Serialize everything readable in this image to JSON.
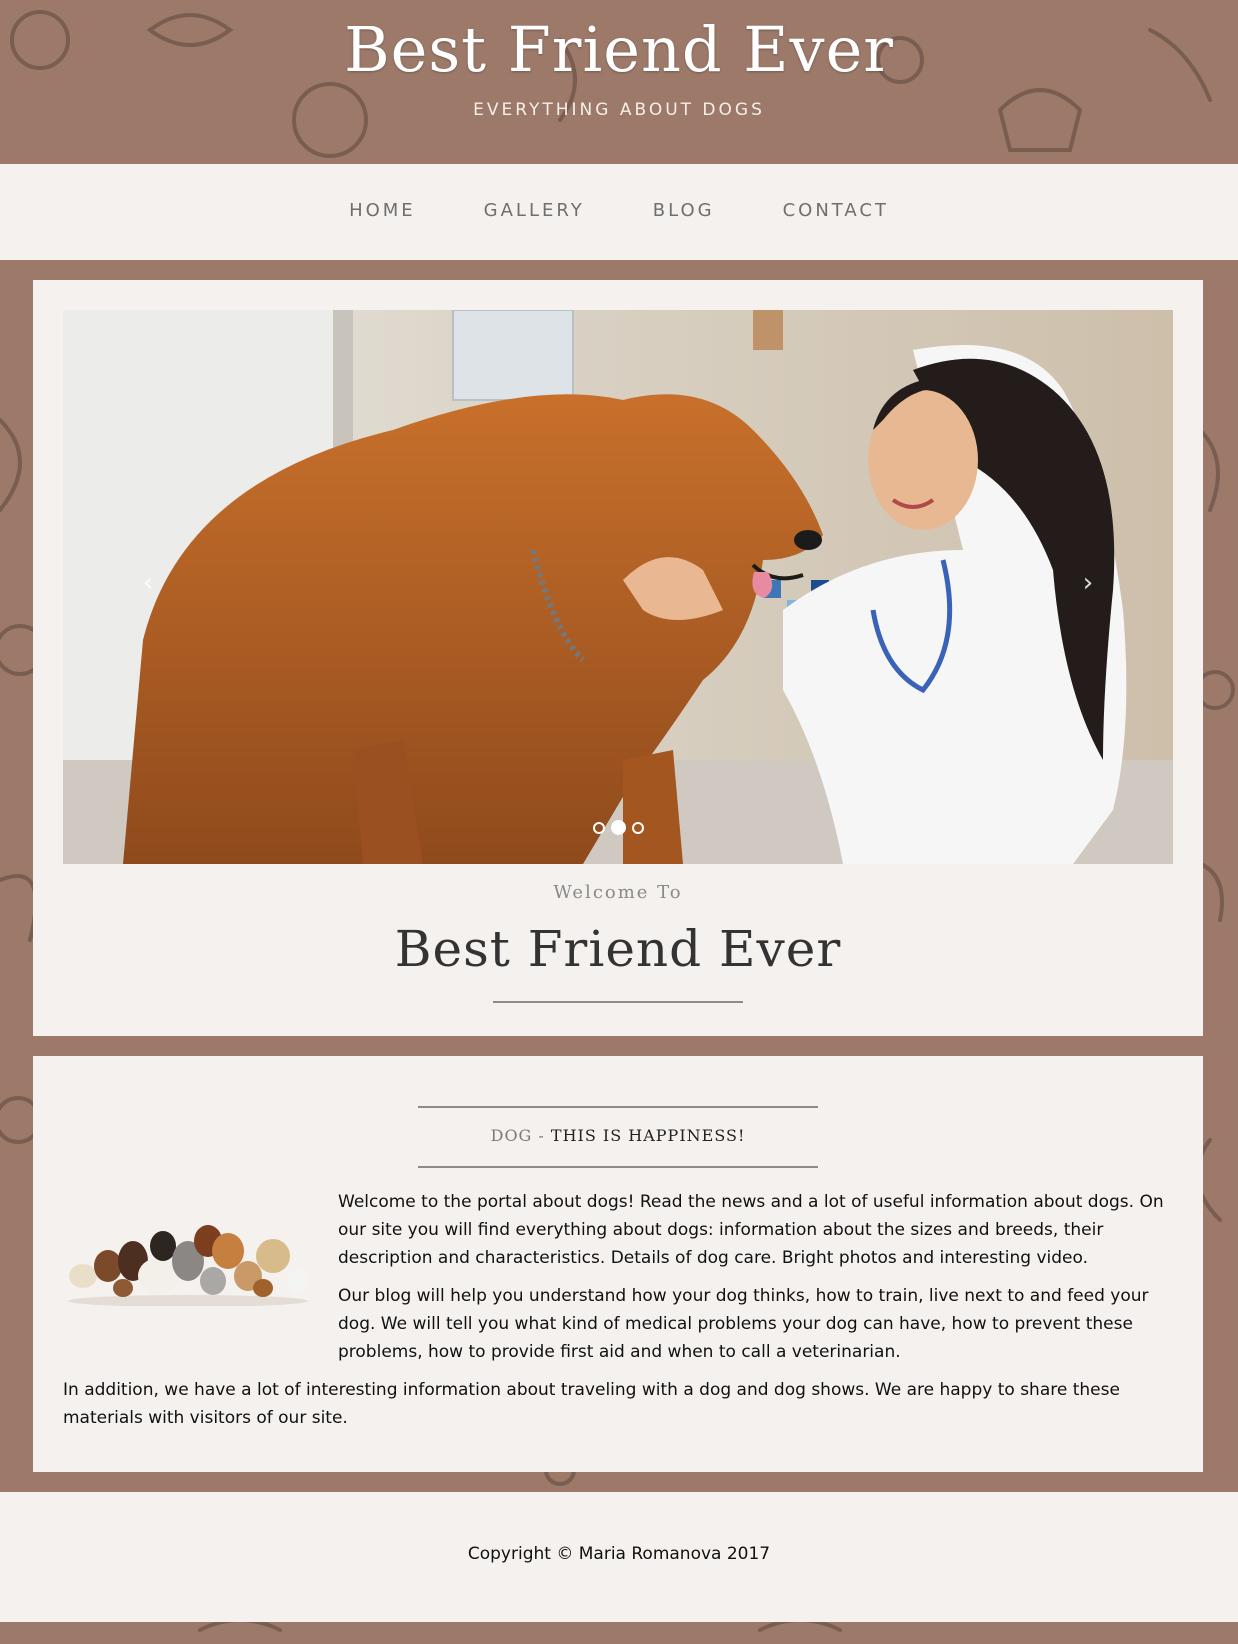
{
  "header": {
    "title": "Best Friend Ever",
    "tagline": "EVERYTHING ABOUT DOGS"
  },
  "nav": {
    "items": [
      {
        "label": "HOME"
      },
      {
        "label": "GALLERY"
      },
      {
        "label": "BLOG"
      },
      {
        "label": "CONTACT"
      }
    ]
  },
  "slider": {
    "prev_icon": "‹",
    "next_icon": "›",
    "slide_count": 3,
    "active_slide": 2
  },
  "welcome": {
    "small": "Welcome To",
    "title": "Best Friend Ever"
  },
  "about": {
    "heading_light": "DOG -",
    "heading_dark": "THIS IS HAPPINESS!",
    "paragraph_1": "Welcome to the portal about dogs! Read the news and a lot of useful information about dogs. On our site you will find everything about dogs: information about the sizes and breeds, their description and characteristics. Details of dog care. Bright photos and interesting video.",
    "paragraph_2": "Our blog will help you understand how your dog thinks, how to train, live next to and feed your dog. We will tell you what kind of medical problems your dog can have, how to prevent these problems, how to provide first aid and when to call a veterinarian.",
    "paragraph_3": "In addition, we have a lot of interesting information about traveling with a dog and dog shows. We are happy to share these materials with visitors of our site."
  },
  "footer": {
    "copyright": "Copyright © Maria Romanova 2017"
  },
  "colors": {
    "brown_background": "#9c7969",
    "panel_background": "#f4f1ee",
    "nav_text": "#6f6f6f"
  }
}
